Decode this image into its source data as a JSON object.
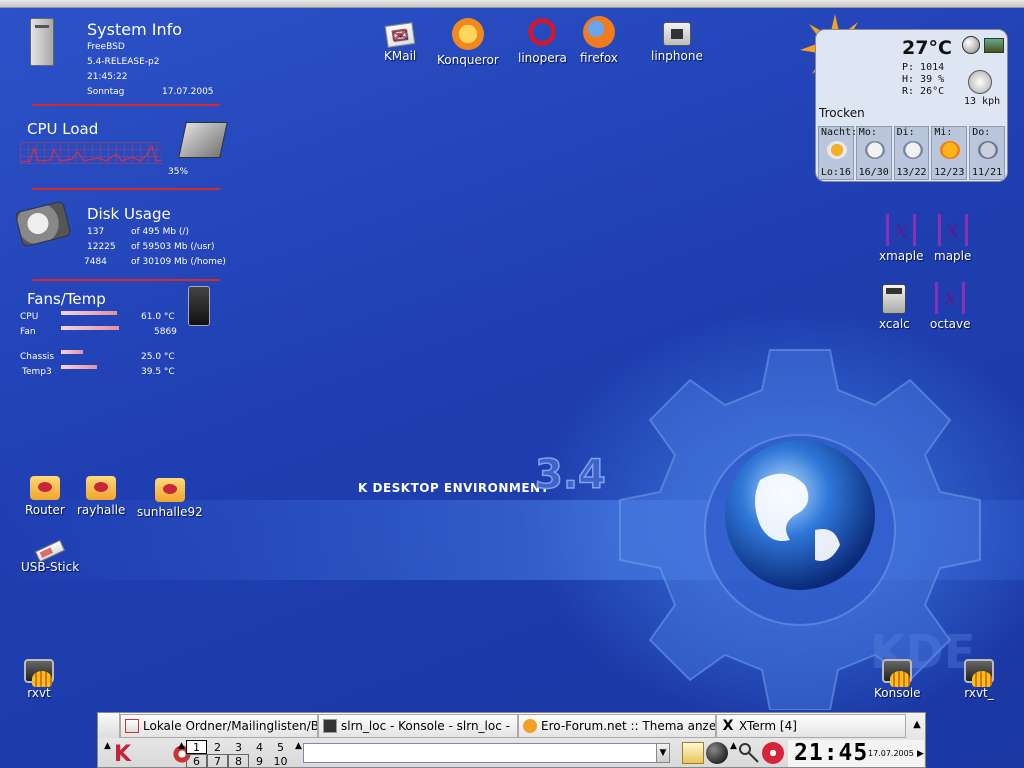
{
  "colors": {
    "desktop_top": "#2d52c8",
    "desktop_bottom": "#1a37a2",
    "separator_red": "#d62a2a",
    "weather_bg": "#dfe6f3"
  },
  "wallpaper": {
    "brand_text": "K DESKTOP ENVIRONMENT",
    "version": "3.4"
  },
  "sysinfo": {
    "title": "System Info",
    "os": "FreeBSD",
    "release": "5.4-RELEASE-p2",
    "time": "21:45:22",
    "day": "Sonntag",
    "date": "17.07.2005"
  },
  "cpu": {
    "title": "CPU Load",
    "percent": "35%"
  },
  "disk": {
    "title": "Disk Usage",
    "rows": [
      {
        "used": "137",
        "total": "of 495 Mb (/)"
      },
      {
        "used": "12225",
        "total": "of 59503 Mb (/usr)"
      },
      {
        "used": "7484",
        "total": "of 30109 Mb (/home)"
      }
    ]
  },
  "fans": {
    "title": "Fans/Temp",
    "rows": [
      {
        "label": "CPU",
        "value": "61.0 °C",
        "level": 0.56
      },
      {
        "label": "Fan",
        "value": "5869",
        "level": 0.58
      },
      {
        "label": "Chassis",
        "value": "25.0 °C",
        "level": 0.22
      },
      {
        "label": "Temp3",
        "value": "39.5 °C",
        "level": 0.36
      }
    ]
  },
  "top_icons": [
    {
      "label": "KMail",
      "icon": "kmail-icon"
    },
    {
      "label": "Konqueror",
      "icon": "konqueror-icon"
    },
    {
      "label": "linopera",
      "icon": "opera-icon"
    },
    {
      "label": "firefox",
      "icon": "firefox-icon"
    },
    {
      "label": "linphone",
      "icon": "linphone-icon"
    }
  ],
  "right_icons": [
    {
      "label": "xmaple",
      "icon": "maple-icon"
    },
    {
      "label": "maple",
      "icon": "maple-icon"
    },
    {
      "label": "xcalc",
      "icon": "calculator-icon"
    },
    {
      "label": "octave",
      "icon": "octave-icon"
    }
  ],
  "left_icons": [
    {
      "label": "Router",
      "icon": "network-folder-icon"
    },
    {
      "label": "rayhalle",
      "icon": "network-folder-icon"
    },
    {
      "label": "sunhalle92",
      "icon": "network-folder-icon"
    },
    {
      "label": "USB-Stick",
      "icon": "usb-stick-icon"
    },
    {
      "label": "rxvt",
      "icon": "terminal-icon"
    }
  ],
  "bottom_right_icons": [
    {
      "label": "Konsole",
      "icon": "terminal-icon"
    },
    {
      "label": "rxvt_",
      "icon": "terminal-icon"
    }
  ],
  "weather": {
    "temp": "27°C",
    "pressure": "P: 1014",
    "humidity": "H: 39 %",
    "dewpoint": "R: 26°C",
    "wind": "13 kph",
    "status": "Trocken",
    "forecast": [
      {
        "day": "Nacht:",
        "temps": "Lo:16"
      },
      {
        "day": "Mo:",
        "temps": "16/30"
      },
      {
        "day": "Di:",
        "temps": "13/22"
      },
      {
        "day": "Mi:",
        "temps": "12/23"
      },
      {
        "day": "Do:",
        "temps": "11/21"
      }
    ]
  },
  "taskbar": {
    "tasks": [
      {
        "label": "Lokale Ordner/Mailinglisten/B",
        "icon": "kmail-icon"
      },
      {
        "label": "slrn_loc - Konsole - slrn_loc -",
        "icon": "konsole-icon"
      },
      {
        "label": "Ero-Forum.net :: Thema anze",
        "icon": "konqueror-icon"
      },
      {
        "label": "XTerm [4]",
        "icon": "xterm-icon"
      }
    ],
    "pager": [
      "1",
      "2",
      "3",
      "4",
      "5",
      "6",
      "7",
      "8",
      "9",
      "10"
    ],
    "command_placeholder": "",
    "clock_time": "21:45",
    "clock_date": "17.07.2005"
  }
}
